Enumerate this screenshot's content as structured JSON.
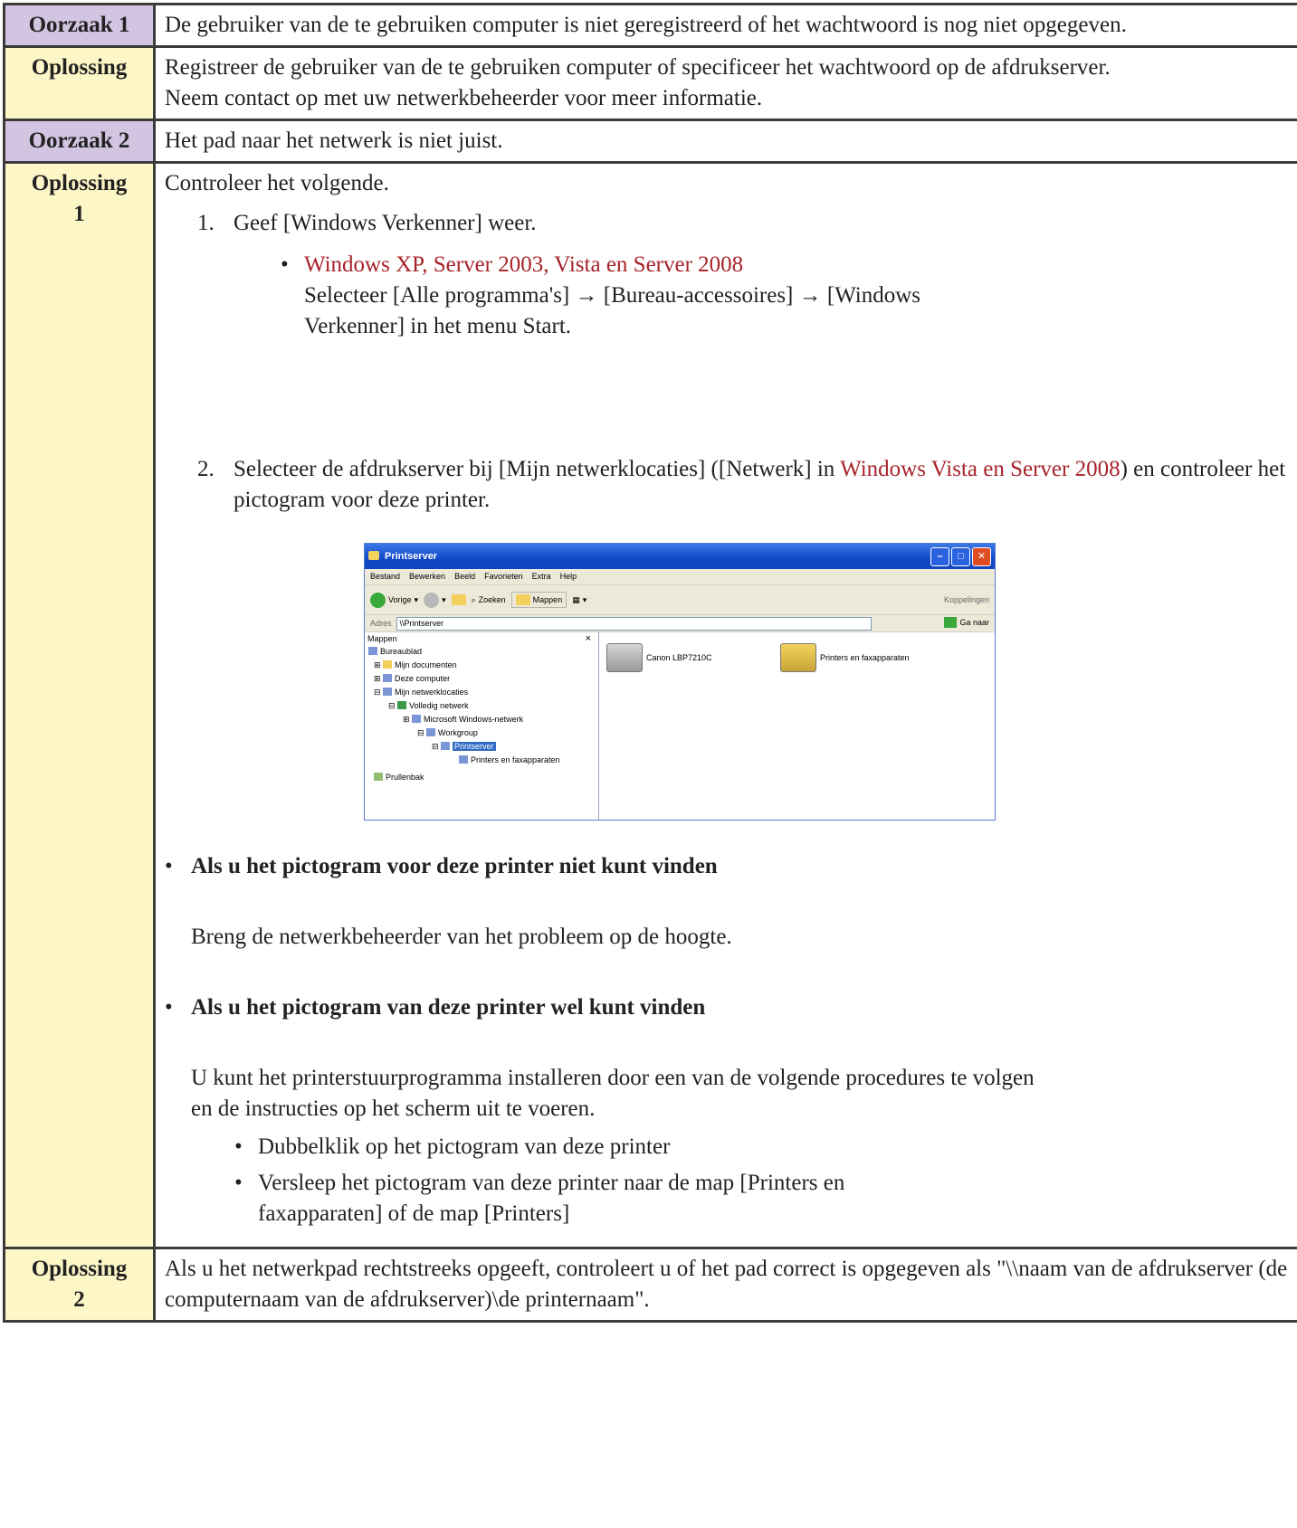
{
  "rows": [
    {
      "label": "Oorzaak 1",
      "text": "De gebruiker van de te gebruiken computer is niet geregistreerd of het wachtwoord is nog niet opgegeven."
    },
    {
      "label": "Oplossing",
      "line1": "Registreer de gebruiker van de te gebruiken computer of specificeer het wachtwoord op de afdrukserver.",
      "line2": "Neem contact op met uw netwerkbeheerder voor meer informatie."
    },
    {
      "label": "Oorzaak 2",
      "text": "Het pad naar het netwerk is niet juist."
    },
    {
      "label_line1": "Oplossing",
      "label_line2": "1",
      "intro": "Controleer het volgende.",
      "step1_num": "1.",
      "step1": "Geef [Windows Verkenner] weer.",
      "os_link": "Windows XP, Server 2003, Vista en Server 2008",
      "os_text": "Selecteer [Alle programma's] → [Bureau-accessoires] → [Windows Verkenner] in het menu Start.",
      "step2_num": "2.",
      "step2_a": "Selecteer de afdrukserver bij [Mijn netwerklocaties] ([Netwerk] in ",
      "step2_link": "Windows Vista en Server 2008",
      "step2_b": ") en controleer het pictogram voor deze printer.",
      "case1_title": "Als u het pictogram voor deze printer niet kunt vinden",
      "case1_text": "Breng de netwerkbeheerder van het probleem op de hoogte.",
      "case2_title": "Als u het pictogram van deze printer wel kunt vinden",
      "case2_text": "U kunt het printerstuurprogramma installeren door een van de volgende procedures te volgen en de instructies op het scherm uit te voeren.",
      "sub1": "Dubbelklik op het pictogram van deze printer",
      "sub2": "Versleep het pictogram van deze printer naar de map [Printers en faxapparaten] of de map [Printers]"
    },
    {
      "label_line1": "Oplossing",
      "label_line2": "2",
      "text": "Als u het netwerkpad rechtstreeks opgeeft, controleert u of het pad correct is opgegeven als \"\\\\naam van de afdrukserver (de computernaam van de afdrukserver)\\de printernaam\"."
    }
  ],
  "screenshot": {
    "title": "Printserver",
    "menu": [
      "Bestand",
      "Bewerken",
      "Beeld",
      "Favorieten",
      "Extra",
      "Help"
    ],
    "toolbar": {
      "back": "Vorige",
      "search": "Zoeken",
      "folders": "Mappen",
      "links": "Koppelingen"
    },
    "address_label": "Adres",
    "address_value": "\\\\Printserver",
    "go_label": "Ga naar",
    "pane_title": "Mappen",
    "pane_close": "×",
    "tree": [
      "Bureaublad",
      "Mijn documenten",
      "Deze computer",
      "Mijn netwerklocaties",
      "Volledig netwerk",
      "Microsoft Windows-netwerk",
      "Workgroup",
      "Printserver",
      "Printers en faxapparaten",
      "Prullenbak"
    ],
    "items": [
      "Canon LBP7210C",
      "Printers en faxapparaten"
    ]
  }
}
